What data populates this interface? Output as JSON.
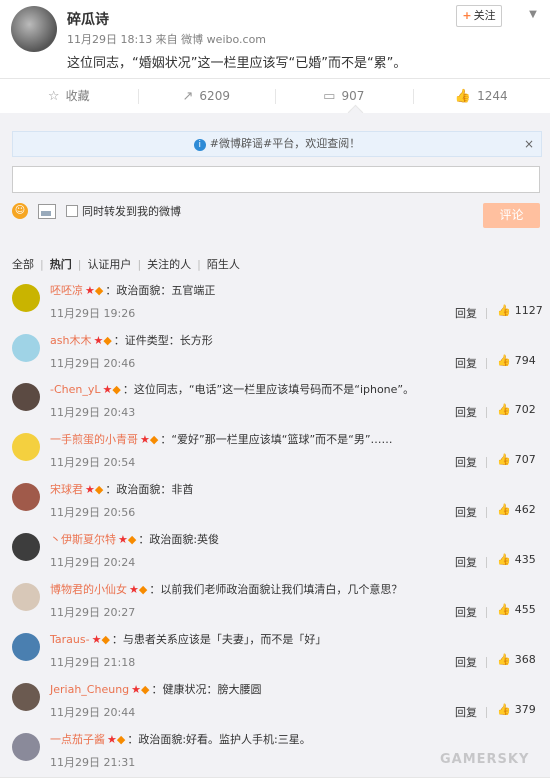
{
  "post": {
    "author": "碎瓜诗",
    "meta": "11月29日 18:13 来自 微博 weibo.com",
    "text": "这位同志，“婚姻状况”这一栏里应该写“已婚”而不是“累”。",
    "follow_label": "关注",
    "follow_plus": "+"
  },
  "actions": [
    {
      "label": "收藏",
      "icon": "star-icon"
    },
    {
      "label": "6209",
      "icon": "share-icon"
    },
    {
      "label": "907",
      "icon": "comment-icon"
    },
    {
      "label": "1244",
      "icon": "thumb-up-icon"
    }
  ],
  "composer": {
    "notice": "#微博辟谣#平台，欢迎查阅！",
    "notice_close": "×",
    "forward_label": "同时转发到我的微博",
    "submit_label": "评论"
  },
  "filters": [
    "全部",
    "热门",
    "认证用户",
    "关注的人",
    "陌生人"
  ],
  "comments": [
    {
      "user": "呸呸凉",
      "text": "：政治面貌：五官端正",
      "time": "11月29日 19:26",
      "likes": "1127",
      "reply": "回复",
      "avatar_color": "#c9b400"
    },
    {
      "user": "ash木木",
      "text": "：证件类型：长方形",
      "time": "11月29日 20:46",
      "likes": "794",
      "reply": "回复",
      "avatar_color": "#9fd3e6"
    },
    {
      "user": "-Chen_yL",
      "text": "：这位同志，“电话”这一栏里应该填号码而不是“iphone”。",
      "time": "11月29日 20:43",
      "likes": "702",
      "reply": "回复",
      "avatar_color": "#5b4a42"
    },
    {
      "user": "一手煎蛋的小青哥",
      "text": "：“爱好”那一栏里应该填“篮球”而不是“男”……",
      "time": "11月29日 20:54",
      "likes": "707",
      "reply": "回复",
      "avatar_color": "#f4d03f"
    },
    {
      "user": "宋球君",
      "text": "：政治面貌：非酋",
      "time": "11月29日 20:56",
      "likes": "462",
      "reply": "回复",
      "avatar_color": "#a05a4a"
    },
    {
      "user": "丶伊斯夏尔特",
      "text": "：政治面貌:英俊",
      "time": "11月29日 20:24",
      "likes": "435",
      "reply": "回复",
      "avatar_color": "#3d3d3d"
    },
    {
      "user": "博物君的小仙女",
      "text": "：以前我们老师政治面貌让我们填清白，几个意思？",
      "time": "11月29日 20:27",
      "likes": "455",
      "reply": "回复",
      "avatar_color": "#d8c8b8"
    },
    {
      "user": "Taraus-",
      "text": "：与患者关系应该是「夫妻」，而不是「好」",
      "time": "11月29日 21:18",
      "likes": "368",
      "reply": "回复",
      "avatar_color": "#4a7fb0"
    },
    {
      "user": "Jeriah_Cheung",
      "text": "：健康状况：膀大腰圆",
      "time": "11月29日 20:44",
      "likes": "379",
      "reply": "回复",
      "avatar_color": "#6b5a50"
    },
    {
      "user": "一点茄子酱",
      "text": "：政治面貌:好看。监护人手机:三星。",
      "time": "11月29日 21:31",
      "likes": "",
      "reply": "",
      "avatar_color": "#8a8a9a"
    }
  ],
  "watermark": "GAMERSKY"
}
